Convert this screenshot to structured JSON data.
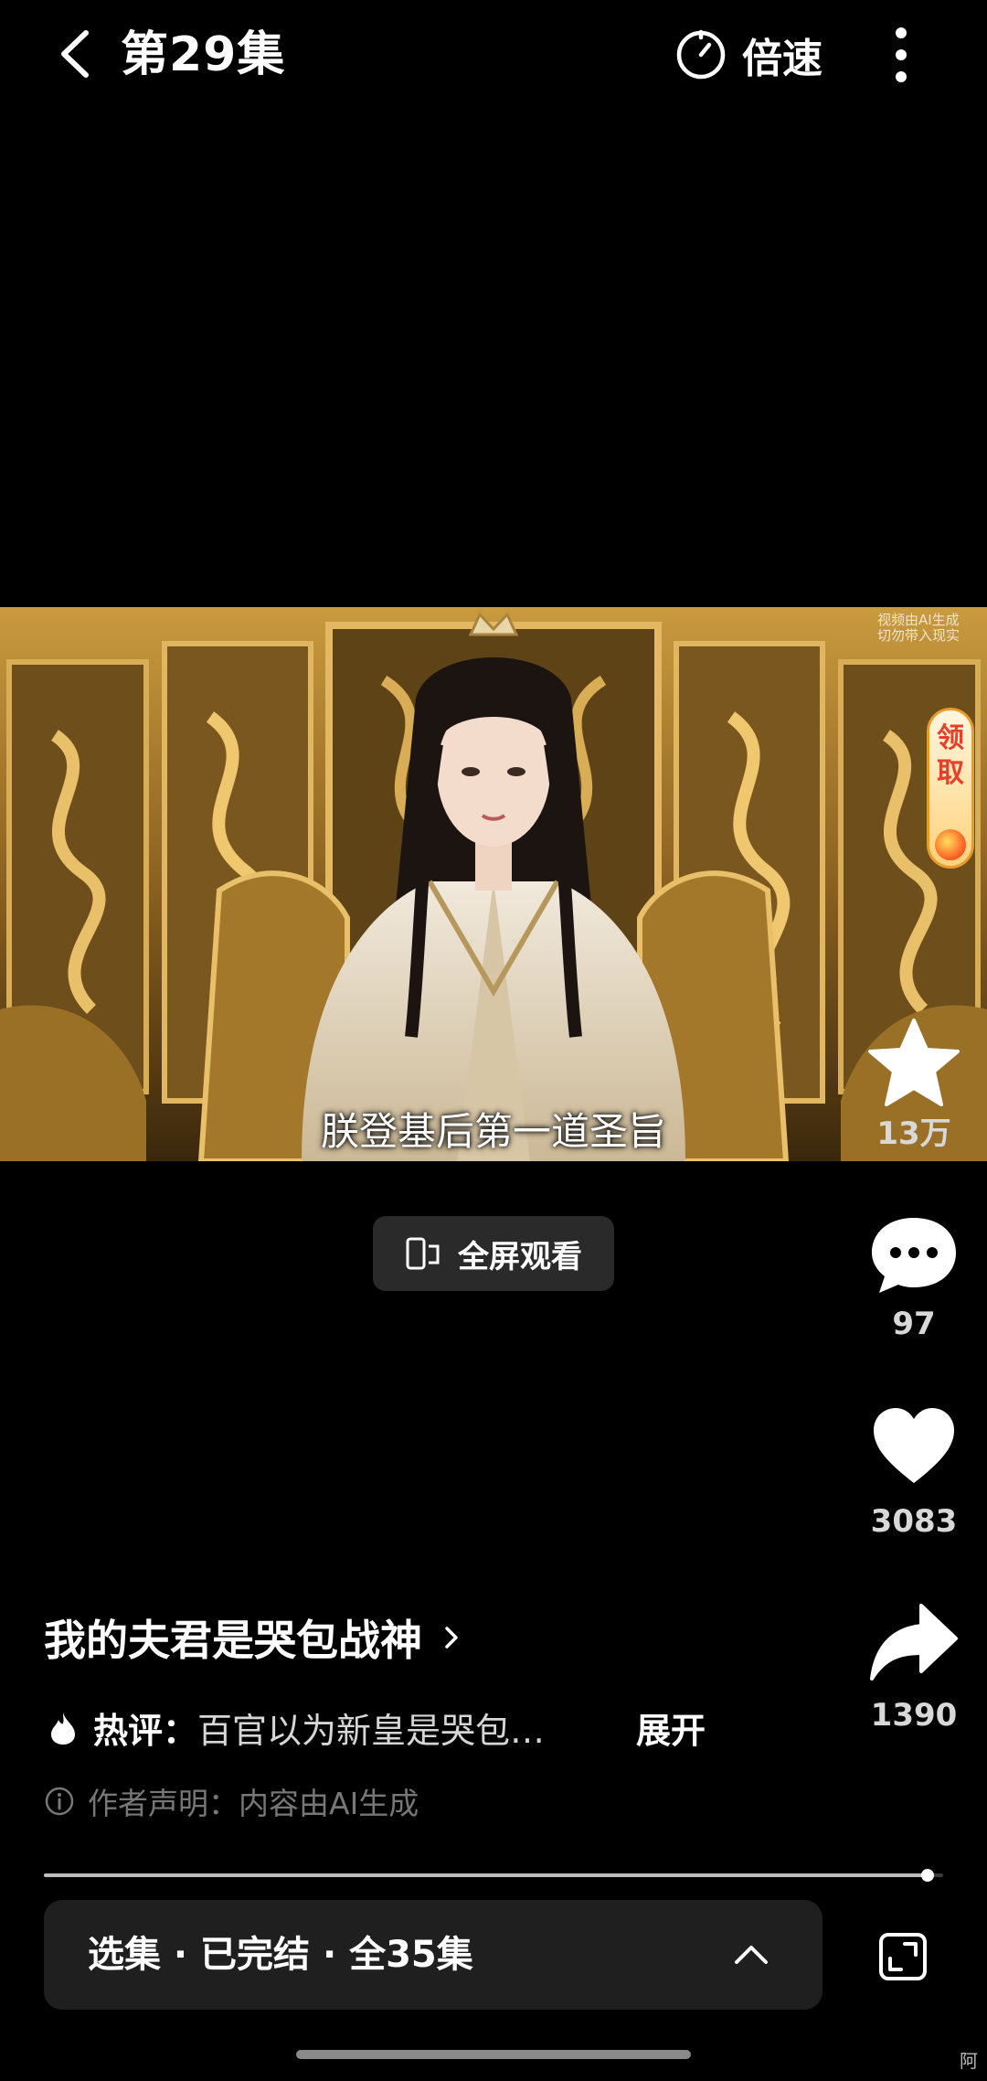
{
  "header": {
    "title": "第29集",
    "speed_label": "倍速"
  },
  "video": {
    "subtitle": "朕登基后第一道圣旨",
    "ai_watermark": [
      "视频由AI生成",
      "切勿带入现实"
    ],
    "reward_badge": "领取"
  },
  "fullscreen": {
    "label": "全屏观看"
  },
  "actions": {
    "collect_count": "13万",
    "comment_count": "97",
    "like_count": "3083",
    "share_count": "1390"
  },
  "info": {
    "drama_title": "我的夫君是哭包战神",
    "hot_label": "热评：",
    "hot_text": "百官以为新皇是哭包…",
    "expand_label": "展开",
    "disclaimer": "作者声明：内容由AI生成"
  },
  "progress": {
    "fraction": 0.983
  },
  "episode_selector": {
    "label": "选集 · 已完结 · 全35集"
  },
  "corner_text": "阿",
  "colors": {
    "background": "#000000",
    "panel": "#1f1f1f",
    "reward_red": "#e6402a"
  }
}
